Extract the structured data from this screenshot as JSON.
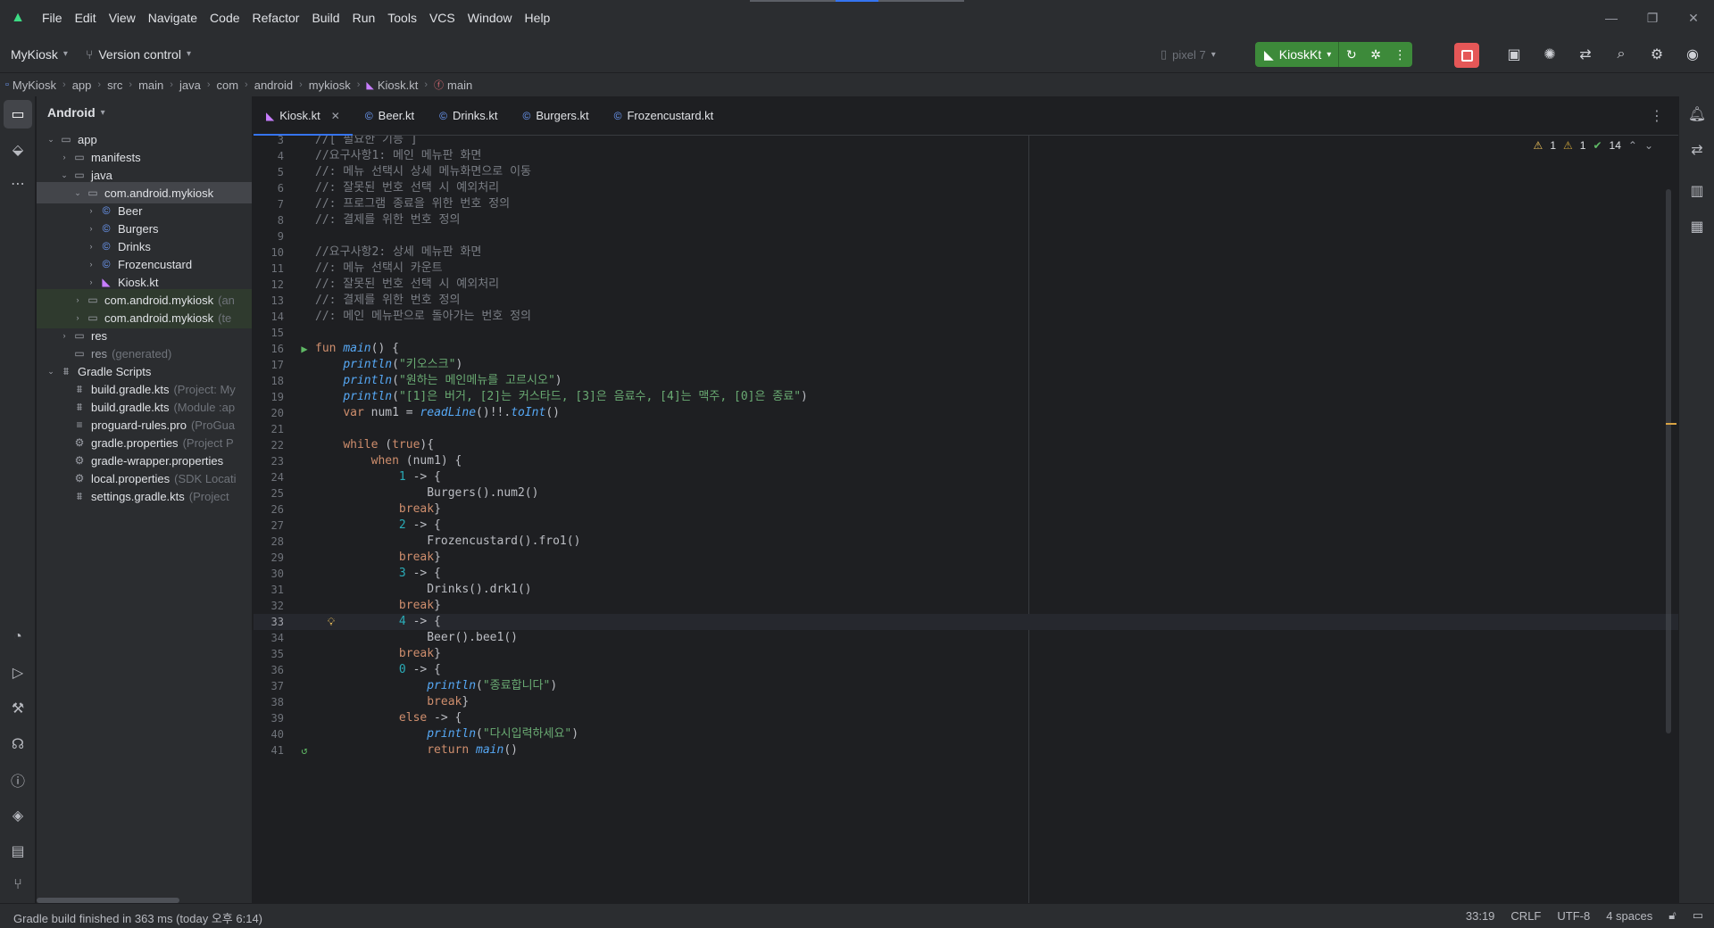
{
  "window": {
    "menu": [
      "File",
      "Edit",
      "View",
      "Navigate",
      "Code",
      "Refactor",
      "Build",
      "Run",
      "Tools",
      "VCS",
      "Window",
      "Help"
    ],
    "controls": {
      "minimize": "—",
      "restore": "❐",
      "close": "✕"
    }
  },
  "toolbar": {
    "project": "MyKiosk",
    "vcs": "Version control",
    "device": "pixel 7",
    "run_config": "KioskKt"
  },
  "breadcrumb": [
    {
      "label": "MyKiosk",
      "icon": "module-icon"
    },
    {
      "label": "app",
      "icon": ""
    },
    {
      "label": "src",
      "icon": ""
    },
    {
      "label": "main",
      "icon": ""
    },
    {
      "label": "java",
      "icon": ""
    },
    {
      "label": "com",
      "icon": ""
    },
    {
      "label": "android",
      "icon": ""
    },
    {
      "label": "mykiosk",
      "icon": ""
    },
    {
      "label": "Kiosk.kt",
      "icon": "kotlin-file-icon"
    },
    {
      "label": "main",
      "icon": "function-icon"
    }
  ],
  "project_panel": {
    "title": "Android",
    "tree": [
      {
        "label": "app",
        "hint": "",
        "indent": 0,
        "arrow": "open",
        "icon": "folder-icon",
        "state": ""
      },
      {
        "label": "manifests",
        "hint": "",
        "indent": 1,
        "arrow": "closed",
        "icon": "folder-icon",
        "state": ""
      },
      {
        "label": "java",
        "hint": "",
        "indent": 1,
        "arrow": "open",
        "icon": "folder-icon",
        "state": ""
      },
      {
        "label": "com.android.mykiosk",
        "hint": "",
        "indent": 2,
        "arrow": "open",
        "icon": "package-icon",
        "state": "selected"
      },
      {
        "label": "Beer",
        "hint": "",
        "indent": 3,
        "arrow": "closed",
        "icon": "class-icon",
        "state": ""
      },
      {
        "label": "Burgers",
        "hint": "",
        "indent": 3,
        "arrow": "closed",
        "icon": "class-icon",
        "state": ""
      },
      {
        "label": "Drinks",
        "hint": "",
        "indent": 3,
        "arrow": "closed",
        "icon": "class-icon",
        "state": ""
      },
      {
        "label": "Frozencustard",
        "hint": "",
        "indent": 3,
        "arrow": "closed",
        "icon": "class-icon",
        "state": ""
      },
      {
        "label": "Kiosk.kt",
        "hint": "",
        "indent": 3,
        "arrow": "closed",
        "icon": "kotlin-file-icon",
        "state": ""
      },
      {
        "label": "com.android.mykiosk",
        "hint": "(an",
        "indent": 2,
        "arrow": "closed",
        "icon": "package-icon",
        "state": "test"
      },
      {
        "label": "com.android.mykiosk",
        "hint": "(te",
        "indent": 2,
        "arrow": "closed",
        "icon": "package-icon",
        "state": "test"
      },
      {
        "label": "res",
        "hint": "",
        "indent": 1,
        "arrow": "closed",
        "icon": "folder-icon",
        "state": ""
      },
      {
        "label": "res",
        "hint": "(generated)",
        "indent": 1,
        "arrow": "none",
        "icon": "folder-icon",
        "state": ""
      },
      {
        "label": "Gradle Scripts",
        "hint": "",
        "indent": 0,
        "arrow": "open",
        "icon": "gradle-icon",
        "state": ""
      },
      {
        "label": "build.gradle.kts",
        "hint": "(Project: My",
        "indent": 1,
        "arrow": "none",
        "icon": "gradle-icon",
        "state": ""
      },
      {
        "label": "build.gradle.kts",
        "hint": "(Module :ap",
        "indent": 1,
        "arrow": "none",
        "icon": "gradle-icon",
        "state": ""
      },
      {
        "label": "proguard-rules.pro",
        "hint": "(ProGua",
        "indent": 1,
        "arrow": "none",
        "icon": "text-file-icon",
        "state": ""
      },
      {
        "label": "gradle.properties",
        "hint": "(Project P",
        "indent": 1,
        "arrow": "none",
        "icon": "settings-file-icon",
        "state": ""
      },
      {
        "label": "gradle-wrapper.properties",
        "hint": "",
        "indent": 1,
        "arrow": "none",
        "icon": "settings-file-icon",
        "state": ""
      },
      {
        "label": "local.properties",
        "hint": "(SDK Locati",
        "indent": 1,
        "arrow": "none",
        "icon": "settings-file-icon",
        "state": ""
      },
      {
        "label": "settings.gradle.kts",
        "hint": "(Project",
        "indent": 1,
        "arrow": "none",
        "icon": "gradle-icon",
        "state": ""
      }
    ]
  },
  "editor": {
    "tabs": [
      {
        "label": "Kiosk.kt",
        "icon": "kotlin-file-icon",
        "active": true
      },
      {
        "label": "Beer.kt",
        "icon": "class-icon",
        "active": false
      },
      {
        "label": "Drinks.kt",
        "icon": "class-icon",
        "active": false
      },
      {
        "label": "Burgers.kt",
        "icon": "class-icon",
        "active": false
      },
      {
        "label": "Frozencustard.kt",
        "icon": "class-icon",
        "active": false
      }
    ],
    "inspections": {
      "warnings": "1",
      "weak_warnings": "1",
      "ok": "14"
    },
    "lines": [
      {
        "n": "3",
        "code": "//[ 필요한 기능 ]",
        "gutter": ""
      },
      {
        "n": "4",
        "code": "//요구사항1: 메인 메뉴판 화면",
        "gutter": ""
      },
      {
        "n": "5",
        "code": "//: 메뉴 선택시 상세 메뉴화면으로 이동",
        "gutter": ""
      },
      {
        "n": "6",
        "code": "//: 잘못된 번호 선택 시 예외처리",
        "gutter": ""
      },
      {
        "n": "7",
        "code": "//: 프로그램 종료을 위한 번호 정의",
        "gutter": ""
      },
      {
        "n": "8",
        "code": "//: 결제를 위한 번호 정의",
        "gutter": ""
      },
      {
        "n": "9",
        "code": "",
        "gutter": ""
      },
      {
        "n": "10",
        "code": "//요구사항2: 상세 메뉴판 화면",
        "gutter": ""
      },
      {
        "n": "11",
        "code": "//: 메뉴 선택시 카운트",
        "gutter": ""
      },
      {
        "n": "12",
        "code": "//: 잘못된 번호 선택 시 예외처리",
        "gutter": ""
      },
      {
        "n": "13",
        "code": "//: 결제를 위한 번호 정의",
        "gutter": ""
      },
      {
        "n": "14",
        "code": "//: 메인 메뉴판으로 돌아가는 번호 정의",
        "gutter": ""
      },
      {
        "n": "15",
        "code": "",
        "gutter": ""
      },
      {
        "n": "16",
        "code": "fun main() {",
        "gutter": "run"
      },
      {
        "n": "17",
        "code": "    println(\"키오스크\")",
        "gutter": ""
      },
      {
        "n": "18",
        "code": "    println(\"원하는 메인메뉴를 고르시오\")",
        "gutter": ""
      },
      {
        "n": "19",
        "code": "    println(\"[1]은 버거, [2]는 커스타드, [3]은 음료수, [4]는 맥주, [0]은 종료\")",
        "gutter": ""
      },
      {
        "n": "20",
        "code": "    var num1 = readLine()!!.toInt()",
        "gutter": ""
      },
      {
        "n": "21",
        "code": "",
        "gutter": ""
      },
      {
        "n": "22",
        "code": "    while (true){",
        "gutter": ""
      },
      {
        "n": "23",
        "code": "        when (num1) {",
        "gutter": ""
      },
      {
        "n": "24",
        "code": "            1 -> {",
        "gutter": ""
      },
      {
        "n": "25",
        "code": "                Burgers().num2()",
        "gutter": ""
      },
      {
        "n": "26",
        "code": "            break}",
        "gutter": ""
      },
      {
        "n": "27",
        "code": "            2 -> {",
        "gutter": ""
      },
      {
        "n": "28",
        "code": "                Frozencustard().fro1()",
        "gutter": ""
      },
      {
        "n": "29",
        "code": "            break}",
        "gutter": ""
      },
      {
        "n": "30",
        "code": "            3 -> {",
        "gutter": ""
      },
      {
        "n": "31",
        "code": "                Drinks().drk1()",
        "gutter": ""
      },
      {
        "n": "32",
        "code": "            break}",
        "gutter": ""
      },
      {
        "n": "33",
        "code": "            4 -> {",
        "gutter": "bulb"
      },
      {
        "n": "34",
        "code": "                Beer().bee1()",
        "gutter": ""
      },
      {
        "n": "35",
        "code": "            break}",
        "gutter": ""
      },
      {
        "n": "36",
        "code": "            0 -> {",
        "gutter": ""
      },
      {
        "n": "37",
        "code": "                println(\"종료합니다\")",
        "gutter": ""
      },
      {
        "n": "38",
        "code": "                break}",
        "gutter": ""
      },
      {
        "n": "39",
        "code": "            else -> {",
        "gutter": ""
      },
      {
        "n": "40",
        "code": "                println(\"다시입력하세요\")",
        "gutter": ""
      },
      {
        "n": "41",
        "code": "                return main()",
        "gutter": "recursion"
      }
    ],
    "current_line": "33"
  },
  "status": {
    "message": "Gradle build finished in 363 ms (today 오후 6:14)",
    "position": "33:19",
    "line_sep": "CRLF",
    "encoding": "UTF-8",
    "indent": "4 spaces"
  },
  "colors": {
    "accent": "#3574f0",
    "run_green": "#3d8a3a",
    "stop_red": "#e55757",
    "keyword": "#cf8e6d",
    "string": "#6aab73",
    "comment": "#7a7e85",
    "number": "#2aacb8",
    "function_call": "#56a8f5"
  }
}
